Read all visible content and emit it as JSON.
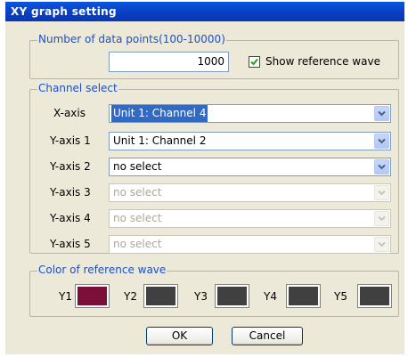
{
  "window": {
    "title": "XY graph setting"
  },
  "data_points": {
    "group_label": "Number of data points(100-10000)",
    "value": "1000",
    "show_reference_checked": true,
    "show_reference_label": "Show reference wave"
  },
  "channel_select": {
    "group_label": "Channel select",
    "rows": [
      {
        "label": "X-axis",
        "value": "Unit 1: Channel 4",
        "state": "selected"
      },
      {
        "label": "Y-axis 1",
        "value": "Unit 1: Channel 2",
        "state": "enabled"
      },
      {
        "label": "Y-axis 2",
        "value": "no select",
        "state": "enabled"
      },
      {
        "label": "Y-axis 3",
        "value": "no select",
        "state": "disabled"
      },
      {
        "label": "Y-axis 4",
        "value": "no select",
        "state": "disabled"
      },
      {
        "label": "Y-axis 5",
        "value": "no select",
        "state": "disabled"
      }
    ]
  },
  "reference_colors": {
    "group_label": "Color of reference wave",
    "items": [
      {
        "label": "Y1",
        "color": "#7a0f3a"
      },
      {
        "label": "Y2",
        "color": "#404040"
      },
      {
        "label": "Y3",
        "color": "#404040"
      },
      {
        "label": "Y4",
        "color": "#404040"
      },
      {
        "label": "Y5",
        "color": "#404040"
      }
    ]
  },
  "buttons": {
    "ok": "OK",
    "cancel": "Cancel"
  }
}
